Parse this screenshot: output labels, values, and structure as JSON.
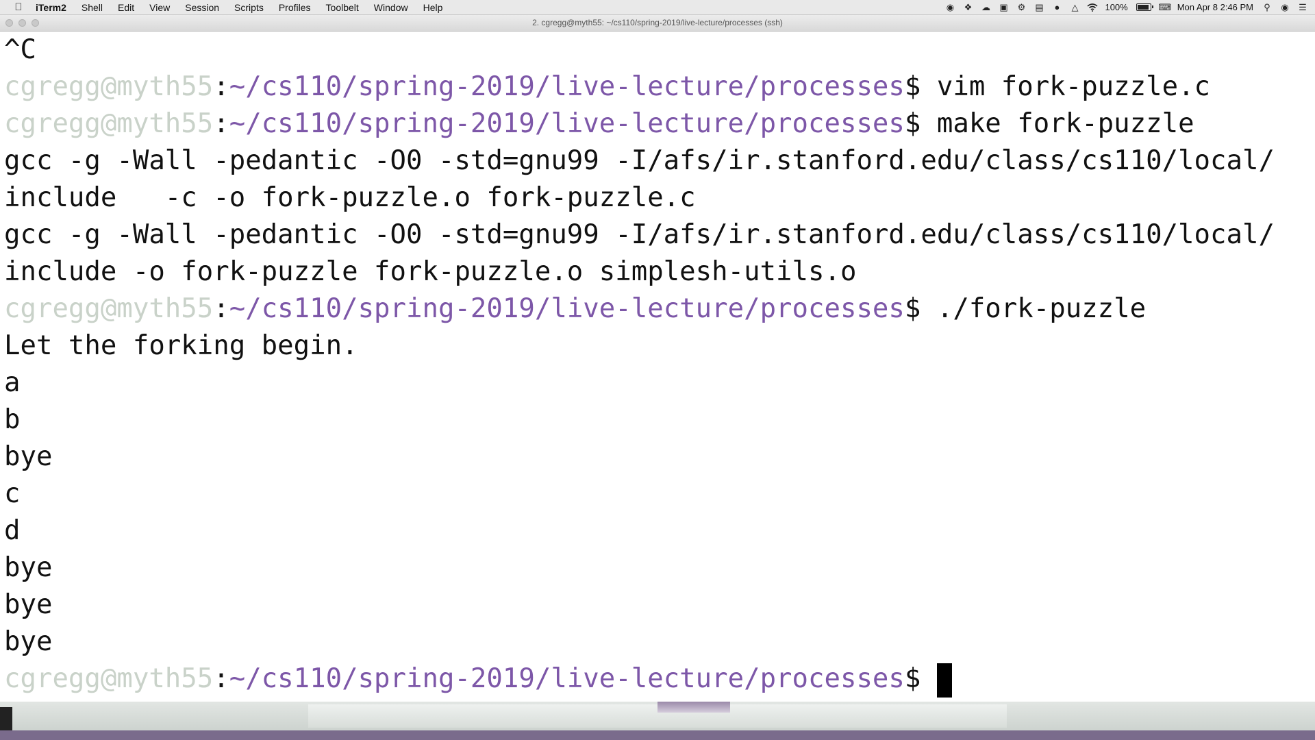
{
  "menubar": {
    "app_name": "iTerm2",
    "items": [
      "Shell",
      "Edit",
      "View",
      "Session",
      "Scripts",
      "Profiles",
      "Toolbelt",
      "Window",
      "Help"
    ],
    "battery_text": "100%",
    "battery_level": 1.0,
    "datetime": "Mon Apr 8  2:46 PM",
    "status_icons": [
      "record-icon",
      "dropbox-icon",
      "cloud-icon",
      "grid-icon",
      "gear-icon",
      "display-icon",
      "dot-icon",
      "airplay-icon",
      "wifi-icon"
    ]
  },
  "window": {
    "title": "2. cgregg@myth55: ~/cs110/spring-2019/live-lecture/processes (ssh)"
  },
  "terminal": {
    "prompt": {
      "user_host": "cgregg@myth55",
      "separator": ":",
      "path": "~/cs110/spring-2019/live-lecture/processes",
      "dollar": "$"
    },
    "lines": {
      "l0": "^C",
      "l1_cmd": " vim fork-puzzle.c",
      "l2_cmd": " make fork-puzzle",
      "l3": "gcc -g -Wall -pedantic -O0 -std=gnu99 -I/afs/ir.stanford.edu/class/cs110/local/",
      "l4": "include   -c -o fork-puzzle.o fork-puzzle.c",
      "l5": "gcc -g -Wall -pedantic -O0 -std=gnu99 -I/afs/ir.stanford.edu/class/cs110/local/",
      "l6": "include -o fork-puzzle fork-puzzle.o simplesh-utils.o",
      "l7_cmd": " ./fork-puzzle",
      "l8": "Let the forking begin.",
      "l9": "a",
      "l10": "b",
      "l11": "bye",
      "l12": "c",
      "l13": "d",
      "l14": "bye",
      "l15": "bye",
      "l16": "bye"
    }
  },
  "colors": {
    "prompt_user": "#c9d2c9",
    "prompt_path": "#7d57a8",
    "text": "#111111",
    "background": "#ffffff"
  }
}
